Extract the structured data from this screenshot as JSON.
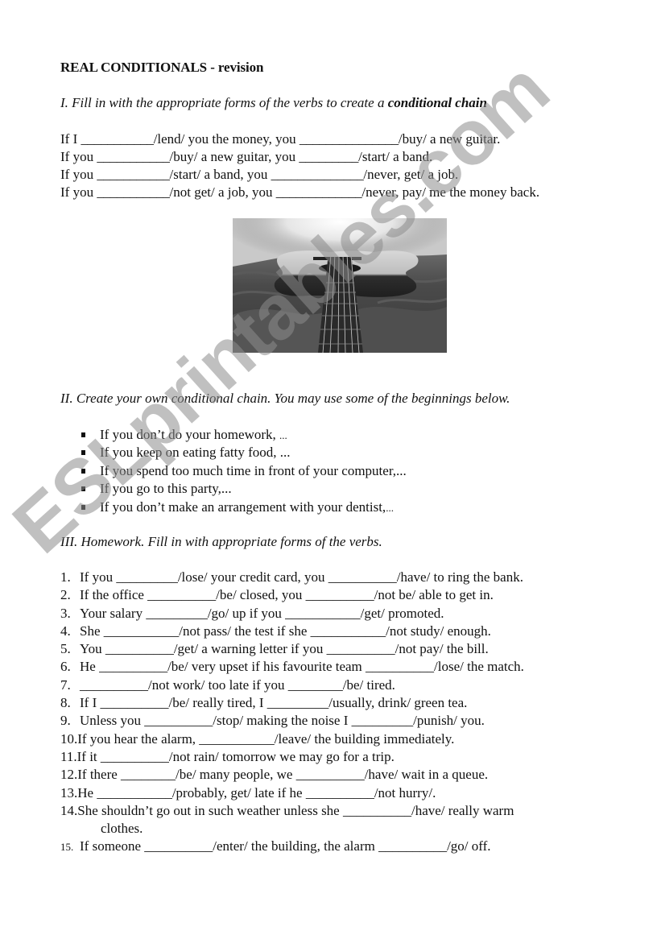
{
  "title": "REAL CONDITIONALS - revision",
  "section1": {
    "instruction_prefix": "I. Fill in with the appropriate forms of the verbs to create a ",
    "instruction_bold": "conditional chain",
    "lines": [
      [
        "If I ",
        "___________",
        "/lend/ you the money, you ",
        "_______________",
        "/buy/ a new guitar."
      ],
      [
        "If you ",
        "___________",
        "/buy/ a new guitar, you ",
        "_________",
        "/start/ a band."
      ],
      [
        "If you ",
        "___________",
        "/start/ a band, you ",
        "______________",
        "/never, get/ a job."
      ],
      [
        "If you ",
        "___________",
        "/not get/ a job, you ",
        "_____________",
        "/never, pay/ me the money back."
      ]
    ],
    "image_alt": "Black and white photo of an acoustic guitar lying on a rumpled bed"
  },
  "section2": {
    "instruction": "II. Create your own conditional chain. You may use some of the beginnings below.",
    "bullets": [
      [
        "If you don’t do your homework, ",
        "..."
      ],
      [
        "If you keep on eating fatty food, ...",
        ""
      ],
      [
        "If you spend too much time in front of your computer,...",
        ""
      ],
      [
        "If you go to this party,...",
        ""
      ],
      [
        "If you don’t make an arrangement with your dentist,",
        "..."
      ]
    ]
  },
  "section3": {
    "instruction": "III. Homework. Fill in with appropriate forms of the verbs.",
    "items": [
      {
        "num": "1.",
        "text": "If you _________/lose/ your credit card, you __________/have/ to ring the bank."
      },
      {
        "num": "2.",
        "text": "If the office __________/be/ closed, you __________/not be/ able to get in."
      },
      {
        "num": "3.",
        "text": "Your salary _________/go/ up if you ___________/get/ promoted."
      },
      {
        "num": "4.",
        "text": "She ___________/not pass/ the test if she ___________/not study/ enough."
      },
      {
        "num": "5.",
        "text": "You __________/get/ a warning letter if you __________/not pay/ the bill."
      },
      {
        "num": "6.",
        "text": "He __________/be/ very upset if his favourite team __________/lose/ the match."
      },
      {
        "num": "7.",
        "text": "__________/not work/ too late if you ________/be/ tired."
      },
      {
        "num": "8.",
        "text": "If I __________/be/ really tired, I _________/usually, drink/ green tea."
      },
      {
        "num": "9.",
        "text": "Unless you __________/stop/ making the noise I _________/punish/ you."
      },
      {
        "num": "10.",
        "text": "If you hear the alarm, ___________/leave/ the building immediately."
      },
      {
        "num": "11.",
        "text": "If it __________/not rain/ tomorrow we may go for a trip."
      },
      {
        "num": "12.",
        "text": "If there ________/be/ many people, we __________/have/ wait in a queue."
      },
      {
        "num": "13.",
        "text": "He ___________/probably, get/ late if he __________/not hurry/."
      },
      {
        "num": "14.",
        "text": "She shouldn’t go out in such weather unless she __________/have/ really warm",
        "cont": "clothes."
      },
      {
        "num": "15.",
        "text": "If someone __________/enter/ the building, the alarm __________/go/ off."
      }
    ]
  },
  "watermark": "ESLprintables.com"
}
